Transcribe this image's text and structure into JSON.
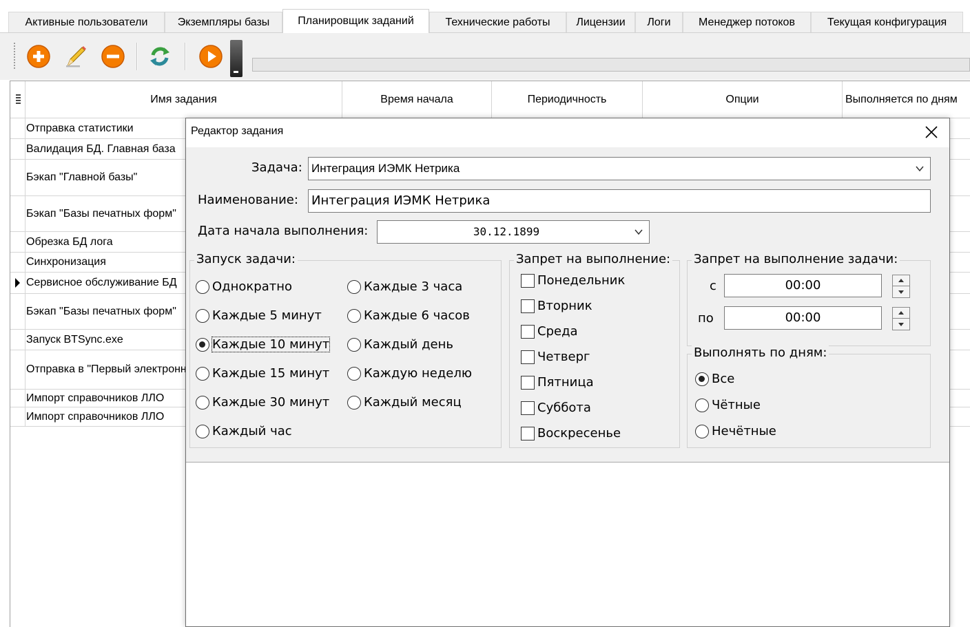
{
  "tabs": [
    {
      "label": "Активные пользователи"
    },
    {
      "label": "Экземпляры базы"
    },
    {
      "label": "Планировщик заданий"
    },
    {
      "label": "Технические работы"
    },
    {
      "label": "Лицензии"
    },
    {
      "label": "Логи"
    },
    {
      "label": "Менеджер потоков"
    },
    {
      "label": "Текущая конфигурация"
    }
  ],
  "active_tab": "Планировщик заданий",
  "toolbar": {
    "icons": [
      "add-icon",
      "edit-icon",
      "delete-icon",
      "refresh-icon",
      "run-icon",
      "dropdown-icon"
    ],
    "progress": 0
  },
  "grid": {
    "columns": [
      "Имя задания",
      "Время начала",
      "Периодичность",
      "Опции",
      "Выполняется по дням"
    ],
    "rows": [
      {
        "name": "Отправка статистики"
      },
      {
        "name": "Валидация БД. Главная база"
      },
      {
        "name": "Бэкап \"Главной базы\""
      },
      {
        "name": "Бэкап \"Базы печатных форм\""
      },
      {
        "name": "Обрезка БД лога"
      },
      {
        "name": "Синхронизация"
      },
      {
        "name": "Сервисное обслуживание БД"
      },
      {
        "name": "Бэкап \"Базы печатных форм\""
      },
      {
        "name": "Запуск BTSync.exe"
      },
      {
        "name": "Отправка в \"Первый электронный\""
      },
      {
        "name": "Импорт справочников ЛЛО"
      },
      {
        "name": "Импорт справочников ЛЛО"
      }
    ]
  },
  "dialog": {
    "title": "Редактор задания",
    "task_label": "Задача:",
    "task_value": "Интеграция ИЭМК Нетрика",
    "name_label": "Наименование:",
    "name_value": "Интеграция ИЭМК Нетрика",
    "start_date_label": "Дата начала выполнения:",
    "start_date_value": "30.12.1899",
    "launch_group": {
      "title": "Запуск задачи:",
      "options": [
        {
          "label": "Однократно",
          "selected": false
        },
        {
          "label": "Каждые 5 минут",
          "selected": false
        },
        {
          "label": "Каждые 10 минут",
          "selected": true
        },
        {
          "label": "Каждые 15 минут",
          "selected": false
        },
        {
          "label": "Каждые 30 минут",
          "selected": false
        },
        {
          "label": "Каждый час",
          "selected": false
        },
        {
          "label": "Каждые 3 часа",
          "selected": false
        },
        {
          "label": "Каждые 6 часов",
          "selected": false
        },
        {
          "label": "Каждый день",
          "selected": false
        },
        {
          "label": "Каждую неделю",
          "selected": false
        },
        {
          "label": "Каждый месяц",
          "selected": false
        }
      ]
    },
    "ban_days_group": {
      "title": "Запрет на выполнение:",
      "days": [
        {
          "label": "Понедельник",
          "checked": false
        },
        {
          "label": "Вторник",
          "checked": false
        },
        {
          "label": "Среда",
          "checked": false
        },
        {
          "label": "Четверг",
          "checked": false
        },
        {
          "label": "Пятница",
          "checked": false
        },
        {
          "label": "Суббота",
          "checked": false
        },
        {
          "label": "Воскресенье",
          "checked": false
        }
      ]
    },
    "ban_time_group": {
      "title": "Запрет на выполнение задачи:",
      "from_label": "с",
      "from_value": "00:00",
      "to_label": "по",
      "to_value": "00:00"
    },
    "days_group": {
      "title": "Выполнять по дням:",
      "options": [
        {
          "label": "Все",
          "selected": true
        },
        {
          "label": "Чётные",
          "selected": false
        },
        {
          "label": "Нечётные",
          "selected": false
        }
      ]
    }
  }
}
